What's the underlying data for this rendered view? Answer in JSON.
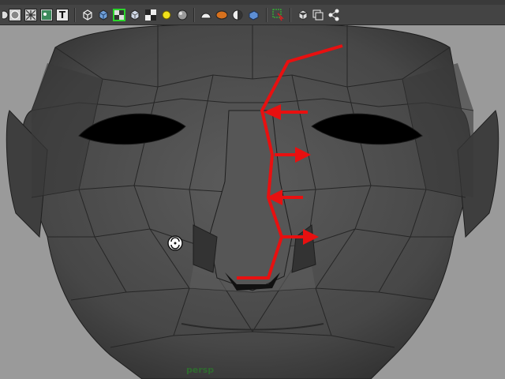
{
  "toolbar": {
    "text_tool_letter": "T",
    "icons": [
      "circle-shading-icon",
      "wireframe-grid-icon",
      "x-ray-icon",
      "textured-icon",
      "text-tool-icon",
      "cube-wireframe-icon",
      "cube-smooth-icon",
      "isolate-select-icon",
      "cube-shaded-icon",
      "checker-icon",
      "default-light-icon",
      "sphere-icon",
      "dome-light-icon",
      "orange-sphere-icon",
      "half-shade-icon",
      "blue-cube-icon",
      "select-cursor-icon",
      "cube-outline-icon",
      "copy-icon",
      "share-nodes-icon"
    ]
  },
  "viewport": {
    "camera_label": "persp",
    "background_color": "#9a9a9a",
    "mesh_color": "#4a4a4a",
    "annotation_color": "#e81010"
  }
}
